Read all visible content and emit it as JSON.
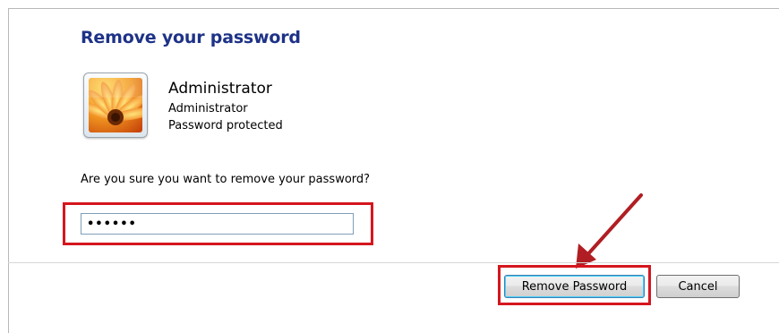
{
  "dialog": {
    "title": "Remove your password"
  },
  "user": {
    "name": "Administrator",
    "role": "Administrator",
    "status": "Password protected",
    "avatar_icon": "flower-avatar-icon"
  },
  "prompt": {
    "question": "Are you sure you want to remove your password?"
  },
  "password_field": {
    "value": "••••••"
  },
  "buttons": {
    "remove_label": "Remove Password",
    "cancel_label": "Cancel"
  },
  "colors": {
    "title": "#1e3287",
    "highlight": "#d5161e",
    "annotation_arrow": "#b01e23"
  }
}
